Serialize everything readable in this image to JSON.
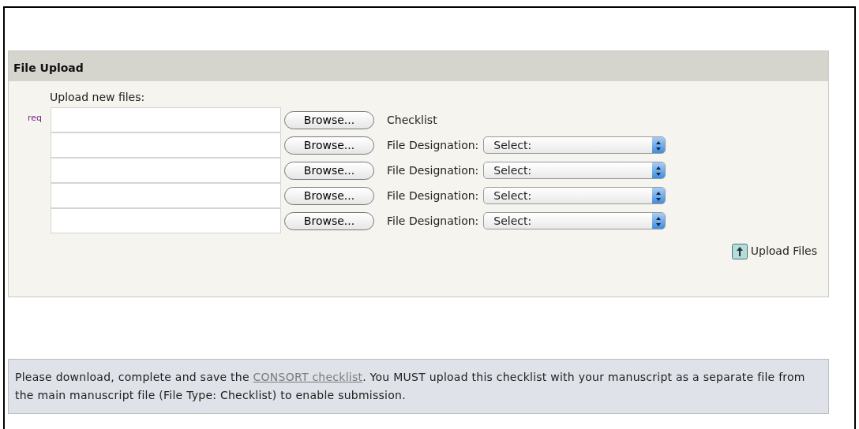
{
  "panel": {
    "title": "File Upload",
    "intro": "Upload new files:",
    "rows": [
      {
        "kind": "label",
        "required_mark": "req",
        "button": "Browse...",
        "label": "Checklist"
      },
      {
        "kind": "select",
        "button": "Browse...",
        "label": "File Designation:",
        "select": "Select:"
      },
      {
        "kind": "select",
        "button": "Browse...",
        "label": "File Designation:",
        "select": "Select:"
      },
      {
        "kind": "select",
        "button": "Browse...",
        "label": "File Designation:",
        "select": "Select:"
      },
      {
        "kind": "select",
        "button": "Browse...",
        "label": "File Designation:",
        "select": "Select:"
      }
    ],
    "upload_button": "Upload Files"
  },
  "notice": {
    "before": "Please download, complete and save the ",
    "link": "CONSORT checklist",
    "after": ". You MUST upload this checklist with your manuscript as a separate file from the main manuscript file (File Type: Checklist) to enable submission."
  }
}
